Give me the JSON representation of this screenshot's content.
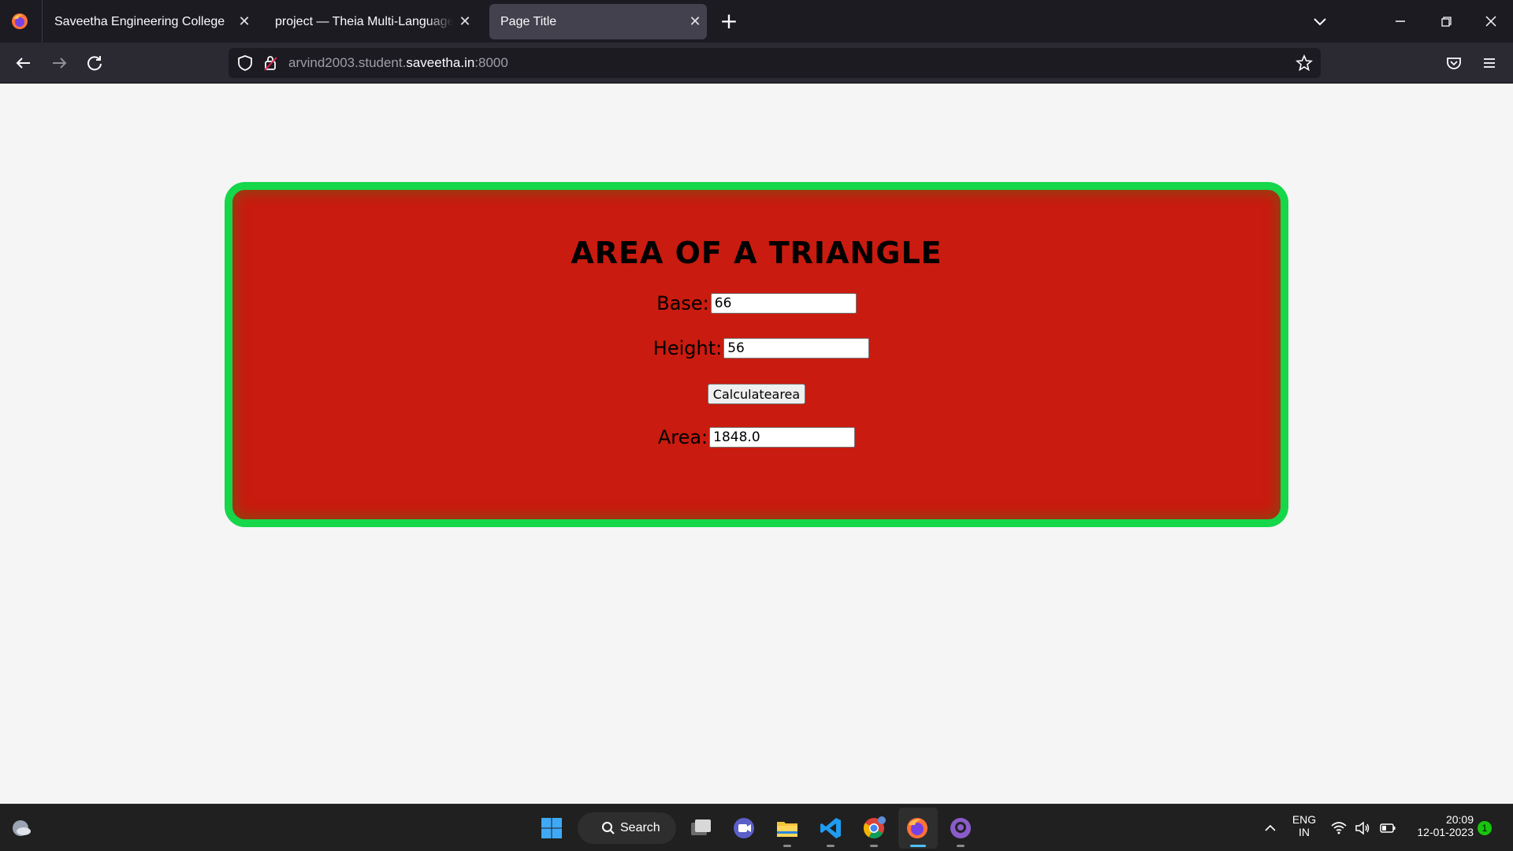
{
  "browser": {
    "tabs": [
      {
        "title": "Saveetha Engineering College",
        "active": false
      },
      {
        "title": "project — Theia Multi-Language Explorer",
        "active": false
      },
      {
        "title": "Page Title",
        "active": true
      }
    ],
    "url": {
      "prefix": "arvind2003.student.",
      "domain": "saveetha.in",
      "suffix": ":8000"
    }
  },
  "page": {
    "heading": "AREA OF A TRIANGLE",
    "base_label": "Base:",
    "base_value": "66",
    "height_label": "Height:",
    "height_value": "56",
    "button_label": "Calculatearea",
    "area_label": "Area:",
    "area_value": "1848.0",
    "colors": {
      "card_bg": "#c91b0f",
      "card_border": "#16d64a"
    }
  },
  "taskbar": {
    "search_label": "Search",
    "lang_line1": "ENG",
    "lang_line2": "IN",
    "time": "20:09",
    "date": "12-01-2023",
    "notification_count": "1",
    "apps": [
      "start-icon",
      "search",
      "task-view-icon",
      "teams-icon",
      "file-explorer-icon",
      "vscode-icon",
      "chrome-icon",
      "firefox-icon",
      "github-desktop-icon"
    ]
  }
}
